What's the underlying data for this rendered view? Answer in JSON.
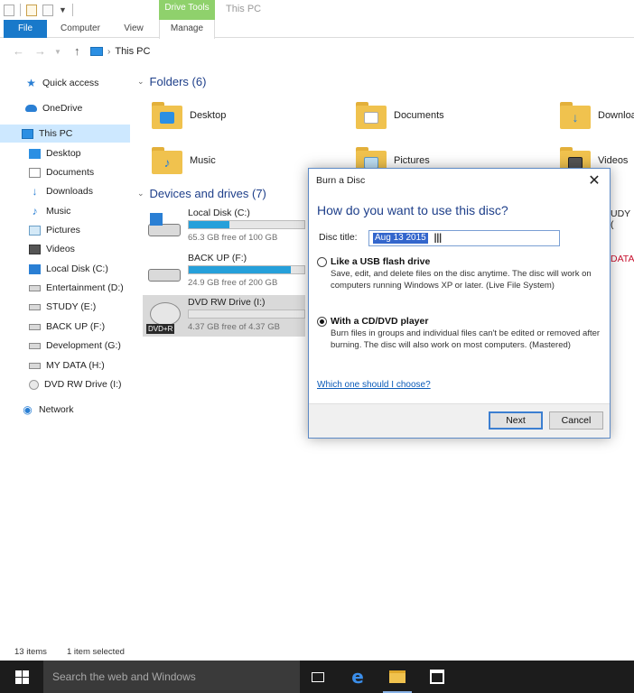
{
  "window": {
    "title": "This PC",
    "context_tab": "Drive Tools"
  },
  "ribbon": {
    "tabs": [
      "File",
      "Computer",
      "View",
      "Manage"
    ]
  },
  "address": {
    "path": [
      "This PC"
    ]
  },
  "nav_pane": {
    "items": [
      {
        "label": "Quick access",
        "icon": "star-icon"
      },
      {
        "label": "OneDrive",
        "icon": "cloud-icon"
      },
      {
        "label": "This PC",
        "icon": "computer-icon",
        "selected": true
      },
      {
        "label": "Desktop",
        "icon": "desktop-icon"
      },
      {
        "label": "Documents",
        "icon": "documents-icon"
      },
      {
        "label": "Downloads",
        "icon": "download-icon"
      },
      {
        "label": "Music",
        "icon": "music-icon"
      },
      {
        "label": "Pictures",
        "icon": "pictures-icon"
      },
      {
        "label": "Videos",
        "icon": "videos-icon"
      },
      {
        "label": "Local Disk (C:)",
        "icon": "windows-drive-icon"
      },
      {
        "label": "Entertainment (D:)",
        "icon": "drive-icon"
      },
      {
        "label": "STUDY (E:)",
        "icon": "drive-icon"
      },
      {
        "label": "BACK UP (F:)",
        "icon": "drive-icon"
      },
      {
        "label": "Development (G:)",
        "icon": "drive-icon"
      },
      {
        "label": "MY DATA (H:)",
        "icon": "drive-icon"
      },
      {
        "label": "DVD RW Drive (I:)",
        "icon": "dvd-icon"
      },
      {
        "label": "Network",
        "icon": "network-icon"
      }
    ]
  },
  "folders": {
    "header": "Folders (6)",
    "items": [
      {
        "name": "Desktop",
        "icon": "desktop-folder-icon"
      },
      {
        "name": "Documents",
        "icon": "documents-folder-icon"
      },
      {
        "name": "Downloa",
        "icon": "downloads-folder-icon"
      },
      {
        "name": "Music",
        "icon": "music-folder-icon"
      },
      {
        "name": "Pictures",
        "icon": "pictures-folder-icon"
      },
      {
        "name": "Videos",
        "icon": "videos-folder-icon"
      }
    ]
  },
  "devices": {
    "header": "Devices and drives (7)",
    "items": [
      {
        "name": "Local Disk (C:)",
        "free": "65.3 GB free of 100 GB",
        "used_fraction": 0.35,
        "icon": "windows-drive-icon"
      },
      {
        "name": "BACK UP (F:)",
        "free": "24.9 GB free of 200 GB",
        "used_fraction": 0.88,
        "icon": "drive-icon"
      },
      {
        "name": "DVD RW Drive (I:)",
        "free": "4.37 GB free of 4.37 GB",
        "used_fraction": 0.0,
        "icon": "dvd-icon",
        "badge": "DVD+R",
        "selected": true
      }
    ],
    "clipped_right": [
      "UDY (",
      "DATA"
    ]
  },
  "dialog": {
    "title": "Burn a Disc",
    "heading": "How do you want to use this disc?",
    "disc_title_label": "Disc title:",
    "disc_title_value": "Aug 13 2015",
    "options": [
      {
        "title": "Like a USB flash drive",
        "desc": "Save, edit, and delete files on the disc anytime. The disc will work on computers running Windows XP or later. (Live File System)",
        "selected": false
      },
      {
        "title": "With a CD/DVD player",
        "desc": "Burn files in groups and individual files can't be edited or removed after burning. The disc will also work on most computers. (Mastered)",
        "selected": true
      }
    ],
    "help_link": "Which one should I choose?",
    "next_label": "Next",
    "cancel_label": "Cancel"
  },
  "statusbar": {
    "items_count": "13 items",
    "selection": "1 item selected"
  },
  "taskbar": {
    "search_placeholder": "Search the web and Windows"
  },
  "colors": {
    "accent": "#1979ca",
    "context_tab": "#8fd16c",
    "drive_bar": "#26a0da",
    "heading_blue": "#1e3f8a"
  }
}
